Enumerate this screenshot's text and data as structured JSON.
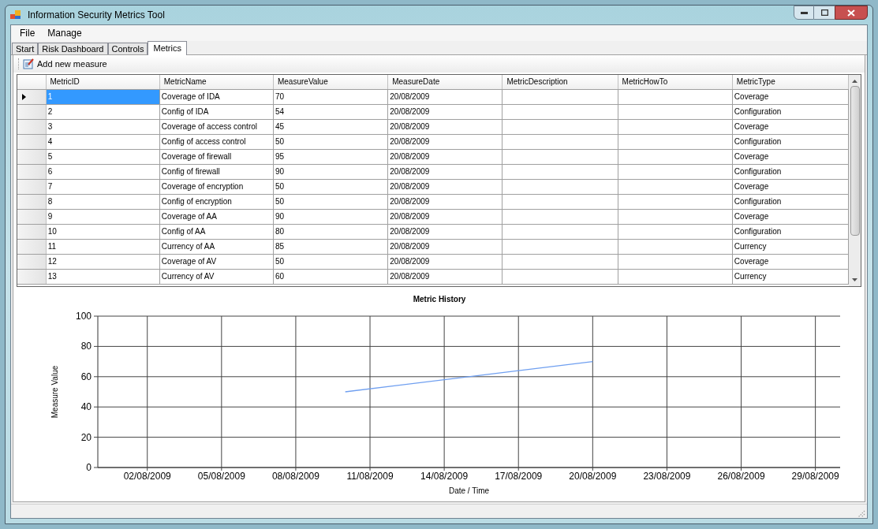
{
  "window": {
    "title": "Information Security Metrics Tool"
  },
  "menu": [
    "File",
    "Manage"
  ],
  "tabs": [
    {
      "label": "Start",
      "selected": false
    },
    {
      "label": "Risk Dashboard",
      "selected": false
    },
    {
      "label": "Controls",
      "selected": false
    },
    {
      "label": "Metrics",
      "selected": true
    }
  ],
  "toolbar": {
    "add_button": "Add new measure"
  },
  "table": {
    "columns": [
      "MetricID",
      "MetricName",
      "MeasureValue",
      "MeasureDate",
      "MetricDescription",
      "MetricHowTo",
      "MetricType"
    ],
    "rows": [
      {
        "selected": true,
        "cells": [
          "1",
          "Coverage of IDA",
          "70",
          "20/08/2009",
          "",
          "",
          "Coverage"
        ]
      },
      {
        "selected": false,
        "cells": [
          "2",
          "Config of IDA",
          "54",
          "20/08/2009",
          "",
          "",
          "Configuration"
        ]
      },
      {
        "selected": false,
        "cells": [
          "3",
          "Coverage of access control",
          "45",
          "20/08/2009",
          "",
          "",
          "Coverage"
        ]
      },
      {
        "selected": false,
        "cells": [
          "4",
          "Config of access control",
          "50",
          "20/08/2009",
          "",
          "",
          "Configuration"
        ]
      },
      {
        "selected": false,
        "cells": [
          "5",
          "Coverage of firewall",
          "95",
          "20/08/2009",
          "",
          "",
          "Coverage"
        ]
      },
      {
        "selected": false,
        "cells": [
          "6",
          "Config of firewall",
          "90",
          "20/08/2009",
          "",
          "",
          "Configuration"
        ]
      },
      {
        "selected": false,
        "cells": [
          "7",
          "Coverage of encryption",
          "50",
          "20/08/2009",
          "",
          "",
          "Coverage"
        ]
      },
      {
        "selected": false,
        "cells": [
          "8",
          "Config of encryption",
          "50",
          "20/08/2009",
          "",
          "",
          "Configuration"
        ]
      },
      {
        "selected": false,
        "cells": [
          "9",
          "Coverage of AA",
          "90",
          "20/08/2009",
          "",
          "",
          "Coverage"
        ]
      },
      {
        "selected": false,
        "cells": [
          "10",
          "Config of AA",
          "80",
          "20/08/2009",
          "",
          "",
          "Configuration"
        ]
      },
      {
        "selected": false,
        "cells": [
          "11",
          "Currency of AA",
          "85",
          "20/08/2009",
          "",
          "",
          "Currency"
        ]
      },
      {
        "selected": false,
        "cells": [
          "12",
          "Coverage of AV",
          "50",
          "20/08/2009",
          "",
          "",
          "Coverage"
        ]
      },
      {
        "selected": false,
        "cells": [
          "13",
          "Currency of AV",
          "60",
          "20/08/2009",
          "",
          "",
          "Currency"
        ]
      }
    ]
  },
  "chart": {
    "chart_data": {
      "type": "line",
      "title": "Metric History",
      "xlabel": "Date / Time",
      "ylabel": "Measure Value",
      "categories": [
        null,
        null,
        "02/08/2009",
        null,
        null,
        "05/08/2009",
        null,
        null,
        "08/08/2009",
        null,
        null,
        "11/08/2009",
        null,
        null,
        "14/08/2009",
        null,
        null,
        "17/08/2009",
        null,
        null,
        "20/08/2009",
        null,
        null,
        "23/08/2009",
        null,
        null,
        "26/08/2009",
        null,
        null,
        "29/08/2009",
        null
      ],
      "series": [
        {
          "color": "#6f9ff0",
          "values": [
            null,
            null,
            null,
            null,
            null,
            null,
            null,
            null,
            null,
            null,
            50,
            null,
            null,
            null,
            null,
            null,
            null,
            null,
            null,
            null,
            70,
            null,
            null,
            null,
            null,
            null,
            null,
            null,
            null,
            null,
            null
          ]
        }
      ],
      "ylim": [
        0,
        100
      ],
      "grid": true,
      "yticks": [
        0,
        20,
        40,
        60,
        80,
        100
      ]
    }
  }
}
